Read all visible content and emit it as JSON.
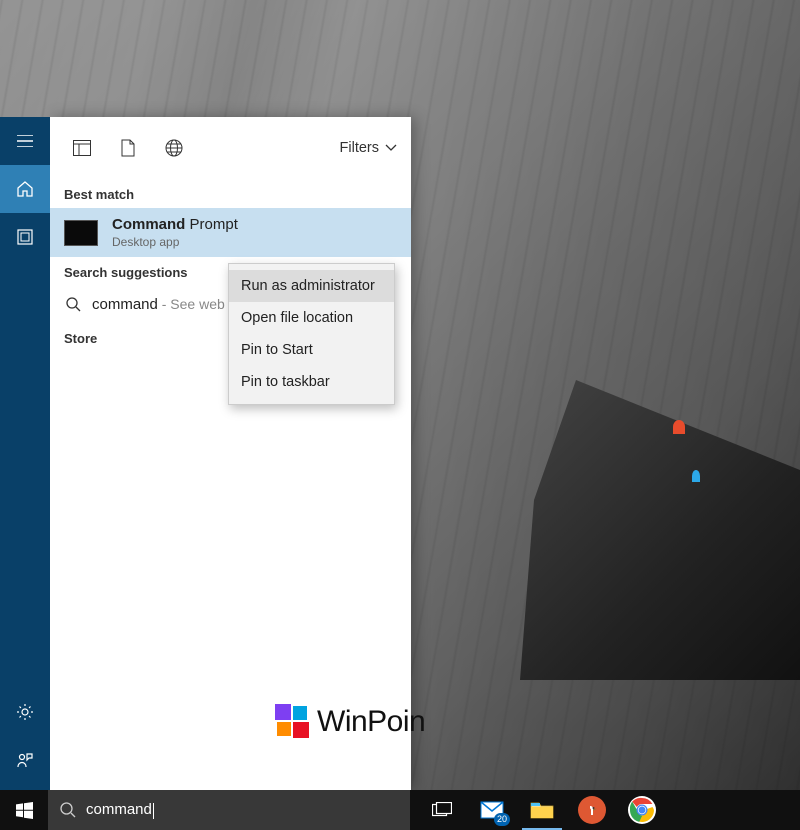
{
  "panel": {
    "filters_label": "Filters",
    "sections": {
      "best_match": "Best match",
      "suggestions": "Search suggestions",
      "store": "Store"
    },
    "result": {
      "title_bold": "Command",
      "title_rest": " Prompt",
      "subtitle": "Desktop app"
    },
    "suggestion": {
      "query": "command",
      "hint": " - See web results"
    }
  },
  "context_menu": {
    "items": [
      "Run as administrator",
      "Open file location",
      "Pin to Start",
      "Pin to taskbar"
    ]
  },
  "watermark": {
    "text": "WinPoin"
  },
  "taskbar": {
    "search_text": "command",
    "mail_badge": "20"
  },
  "colors": {
    "rail_bg": "#094068",
    "rail_active": "#2f80b5",
    "selection_bg": "#c7dff0",
    "taskbar_bg": "#101010",
    "search_bg": "#383838"
  }
}
